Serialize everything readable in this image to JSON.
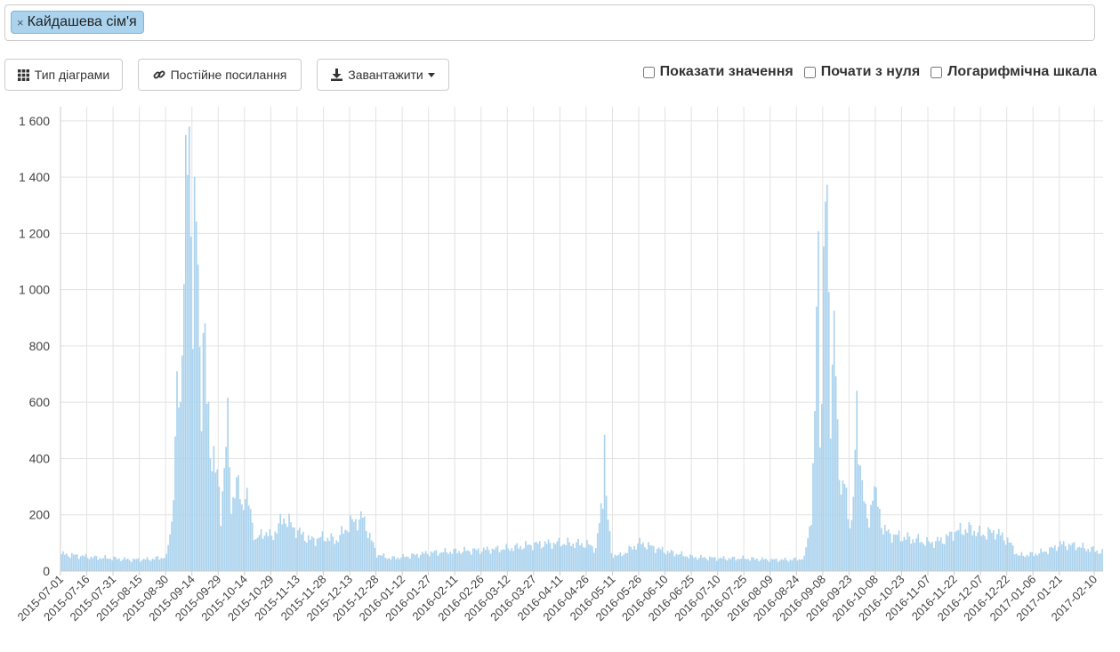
{
  "search": {
    "tag_label": "Кайдашева сім'я",
    "remove_symbol": "×"
  },
  "toolbar": {
    "chart_type_label": "Тип діаграми",
    "permalink_label": "Постійне посилання",
    "download_label": "Завантажити"
  },
  "options": {
    "show_values_label": "Показати значення",
    "start_zero_label": "Почати з нуля",
    "log_scale_label": "Логарифмічна шкала"
  },
  "colors": {
    "bar": "#abd3ee",
    "grid": "#e3e3e3",
    "axis": "#cccccc",
    "label": "#444444"
  },
  "chart_data": {
    "type": "bar",
    "grid": true,
    "ylim": [
      0,
      1650
    ],
    "yticks": [
      0,
      200,
      400,
      600,
      800,
      1000,
      1200,
      1400,
      1600
    ],
    "ytick_labels": [
      "0",
      "200",
      "400",
      "600",
      "800",
      "1 000",
      "1 200",
      "1 400",
      "1 600"
    ],
    "xlim": [
      "2015-07-01",
      "2017-02-14"
    ],
    "xticks": [
      "2015-07-01",
      "2015-07-16",
      "2015-07-31",
      "2015-08-15",
      "2015-08-30",
      "2015-09-14",
      "2015-09-29",
      "2015-10-14",
      "2015-10-29",
      "2015-11-13",
      "2015-11-28",
      "2015-12-13",
      "2015-12-28",
      "2016-01-12",
      "2016-01-27",
      "2016-02-11",
      "2016-02-26",
      "2016-03-12",
      "2016-03-27",
      "2016-04-11",
      "2016-04-26",
      "2016-05-11",
      "2016-05-26",
      "2016-06-10",
      "2016-06-25",
      "2016-07-10",
      "2016-07-25",
      "2016-08-09",
      "2016-08-24",
      "2016-09-08",
      "2016-09-23",
      "2016-10-08",
      "2016-10-23",
      "2016-11-07",
      "2016-11-22",
      "2016-12-07",
      "2016-12-22",
      "2017-01-06",
      "2017-01-21",
      "2017-02-10"
    ],
    "points": [
      [
        "2015-07-01",
        60
      ],
      [
        "2015-07-10",
        55
      ],
      [
        "2015-07-20",
        48
      ],
      [
        "2015-07-31",
        45
      ],
      [
        "2015-08-10",
        40
      ],
      [
        "2015-08-20",
        42
      ],
      [
        "2015-08-30",
        50
      ],
      [
        "2015-09-02",
        180
      ],
      [
        "2015-09-04",
        430
      ],
      [
        "2015-09-05",
        630
      ],
      [
        "2015-09-07",
        570
      ],
      [
        "2015-09-08",
        920
      ],
      [
        "2015-09-09",
        1110
      ],
      [
        "2015-09-10",
        1340
      ],
      [
        "2015-09-11",
        1400
      ],
      [
        "2015-09-12",
        1445
      ],
      [
        "2015-09-13",
        1220
      ],
      [
        "2015-09-14",
        1000
      ],
      [
        "2015-09-15",
        1320
      ],
      [
        "2015-09-16",
        1200
      ],
      [
        "2015-09-17",
        1030
      ],
      [
        "2015-09-18",
        700
      ],
      [
        "2015-09-19",
        600
      ],
      [
        "2015-09-20",
        920
      ],
      [
        "2015-09-21",
        850
      ],
      [
        "2015-09-22",
        610
      ],
      [
        "2015-09-24",
        400
      ],
      [
        "2015-09-26",
        440
      ],
      [
        "2015-09-28",
        330
      ],
      [
        "2015-09-30",
        180
      ],
      [
        "2015-10-02",
        400
      ],
      [
        "2015-10-03",
        480
      ],
      [
        "2015-10-04",
        510
      ],
      [
        "2015-10-06",
        210
      ],
      [
        "2015-10-08",
        320
      ],
      [
        "2015-10-10",
        300
      ],
      [
        "2015-10-12",
        220
      ],
      [
        "2015-10-14",
        290
      ],
      [
        "2015-10-16",
        230
      ],
      [
        "2015-10-20",
        110
      ],
      [
        "2015-10-25",
        140
      ],
      [
        "2015-10-29",
        120
      ],
      [
        "2015-11-05",
        190
      ],
      [
        "2015-11-13",
        140
      ],
      [
        "2015-11-20",
        110
      ],
      [
        "2015-11-28",
        120
      ],
      [
        "2015-12-05",
        110
      ],
      [
        "2015-12-13",
        170
      ],
      [
        "2015-12-20",
        190
      ],
      [
        "2015-12-28",
        60
      ],
      [
        "2016-01-05",
        45
      ],
      [
        "2016-01-12",
        50
      ],
      [
        "2016-01-27",
        65
      ],
      [
        "2016-02-11",
        70
      ],
      [
        "2016-02-26",
        75
      ],
      [
        "2016-03-12",
        80
      ],
      [
        "2016-03-27",
        95
      ],
      [
        "2016-04-11",
        100
      ],
      [
        "2016-04-26",
        95
      ],
      [
        "2016-05-01",
        80
      ],
      [
        "2016-05-05",
        255
      ],
      [
        "2016-05-06",
        560
      ],
      [
        "2016-05-07",
        250
      ],
      [
        "2016-05-10",
        60
      ],
      [
        "2016-05-15",
        55
      ],
      [
        "2016-05-26",
        100
      ],
      [
        "2016-06-10",
        70
      ],
      [
        "2016-06-25",
        50
      ],
      [
        "2016-07-10",
        45
      ],
      [
        "2016-07-25",
        45
      ],
      [
        "2016-08-09",
        40
      ],
      [
        "2016-08-20",
        40
      ],
      [
        "2016-08-28",
        45
      ],
      [
        "2016-09-01",
        200
      ],
      [
        "2016-09-03",
        500
      ],
      [
        "2016-09-04",
        970
      ],
      [
        "2016-09-05",
        1140
      ],
      [
        "2016-09-06",
        520
      ],
      [
        "2016-09-07",
        660
      ],
      [
        "2016-09-08",
        1000
      ],
      [
        "2016-09-09",
        1300
      ],
      [
        "2016-09-10",
        1260
      ],
      [
        "2016-09-11",
        1000
      ],
      [
        "2016-09-12",
        600
      ],
      [
        "2016-09-13",
        700
      ],
      [
        "2016-09-14",
        890
      ],
      [
        "2016-09-15",
        660
      ],
      [
        "2016-09-16",
        470
      ],
      [
        "2016-09-18",
        300
      ],
      [
        "2016-09-20",
        320
      ],
      [
        "2016-09-22",
        180
      ],
      [
        "2016-09-24",
        180
      ],
      [
        "2016-09-26",
        400
      ],
      [
        "2016-09-27",
        540
      ],
      [
        "2016-09-28",
        420
      ],
      [
        "2016-09-30",
        350
      ],
      [
        "2016-10-02",
        200
      ],
      [
        "2016-10-04",
        160
      ],
      [
        "2016-10-06",
        310
      ],
      [
        "2016-10-08",
        260
      ],
      [
        "2016-10-12",
        150
      ],
      [
        "2016-10-16",
        130
      ],
      [
        "2016-10-23",
        120
      ],
      [
        "2016-11-01",
        110
      ],
      [
        "2016-11-07",
        100
      ],
      [
        "2016-11-15",
        110
      ],
      [
        "2016-11-22",
        140
      ],
      [
        "2016-12-01",
        150
      ],
      [
        "2016-12-07",
        130
      ],
      [
        "2016-12-15",
        140
      ],
      [
        "2016-12-22",
        110
      ],
      [
        "2016-12-28",
        55
      ],
      [
        "2017-01-06",
        60
      ],
      [
        "2017-01-15",
        75
      ],
      [
        "2017-01-21",
        95
      ],
      [
        "2017-01-30",
        90
      ],
      [
        "2017-02-05",
        80
      ],
      [
        "2017-02-10",
        75
      ],
      [
        "2017-02-14",
        65
      ]
    ]
  }
}
